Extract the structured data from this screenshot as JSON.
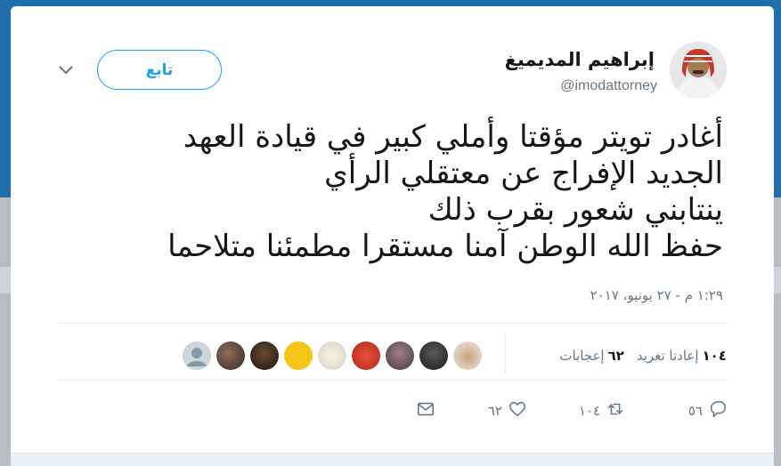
{
  "tweet": {
    "author_name": "إبراهيم المديميغ",
    "handle": "@imodattorney",
    "follow_label": "تابع",
    "text_lines": [
      "أغادر تويتر مؤقتا وأملي كبير في قيادة العهد",
      "الجديد الإفراج عن معتقلي الرأي",
      "ينتابني شعور بقرب ذلك",
      "حفظ الله الوطن آمنا مستقرا مطمئنا متلاحما"
    ],
    "timestamp": "١:٢٩ م - ٢٧ يونيو، ٢٠١٧",
    "stats": {
      "retweets_count": "١٠٤",
      "retweets_label": "إعادتا تغريد",
      "likes_count": "٦٢",
      "likes_label": "إعجابات"
    },
    "actions": {
      "reply_count": "٥٦",
      "retweet_count": "١٠٤",
      "like_count": "٦٢"
    }
  },
  "icons": {
    "reply": "reply-icon",
    "retweet": "retweet-icon",
    "like": "heart-icon",
    "message": "envelope-icon",
    "caret": "chevron-down-icon"
  },
  "colors": {
    "accent": "#1da1f2",
    "muted": "#657786",
    "text": "#14171a",
    "header_bg": "#1f6fac"
  }
}
